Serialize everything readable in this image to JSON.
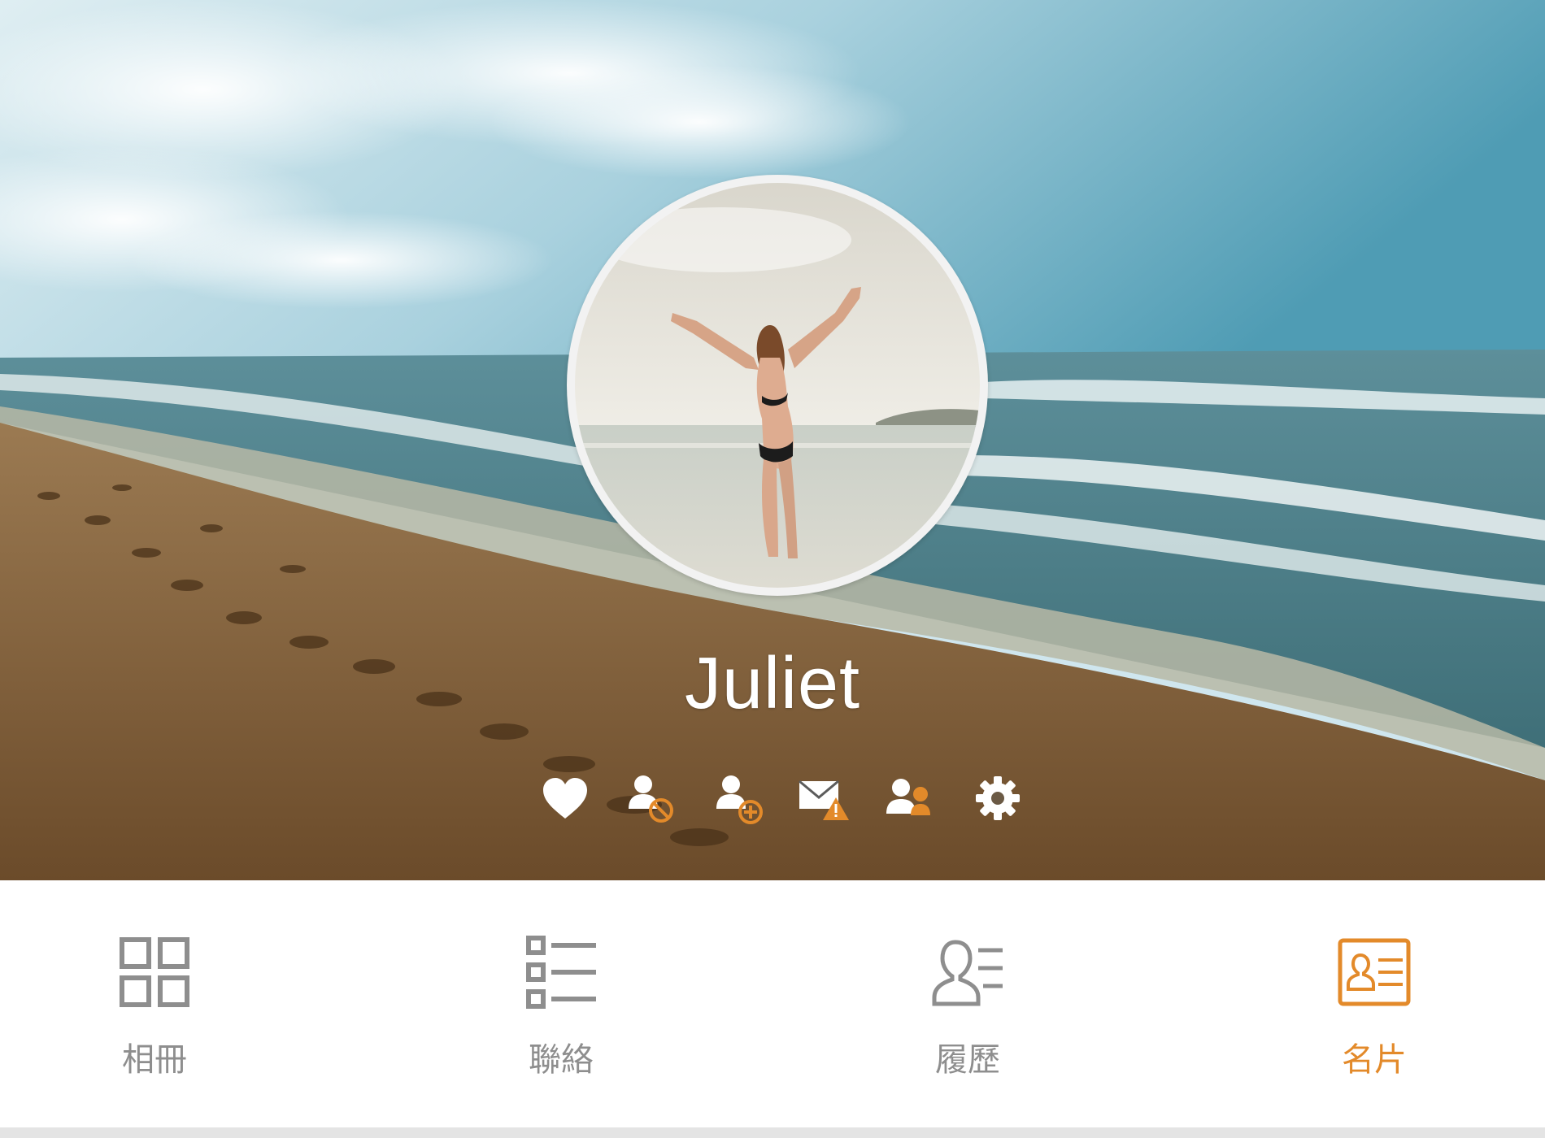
{
  "profile": {
    "name": "Juliet"
  },
  "actions": [
    {
      "icon": "heart-icon",
      "label": "favorite"
    },
    {
      "icon": "user-block-icon",
      "label": "block"
    },
    {
      "icon": "user-add-icon",
      "label": "add-friend"
    },
    {
      "icon": "mail-warning-icon",
      "label": "report"
    },
    {
      "icon": "users-icon",
      "label": "friends"
    },
    {
      "icon": "gear-icon",
      "label": "settings"
    }
  ],
  "tabs": [
    {
      "label": "相冊",
      "icon": "grid-icon",
      "active": false
    },
    {
      "label": "聯絡",
      "icon": "list-icon",
      "active": false
    },
    {
      "label": "履歷",
      "icon": "user-profile-icon",
      "active": false
    },
    {
      "label": "名片",
      "icon": "id-card-icon",
      "active": true
    }
  ],
  "colors": {
    "accent": "#e38a2a",
    "inactive": "#8e8e8e",
    "white": "#ffffff"
  }
}
